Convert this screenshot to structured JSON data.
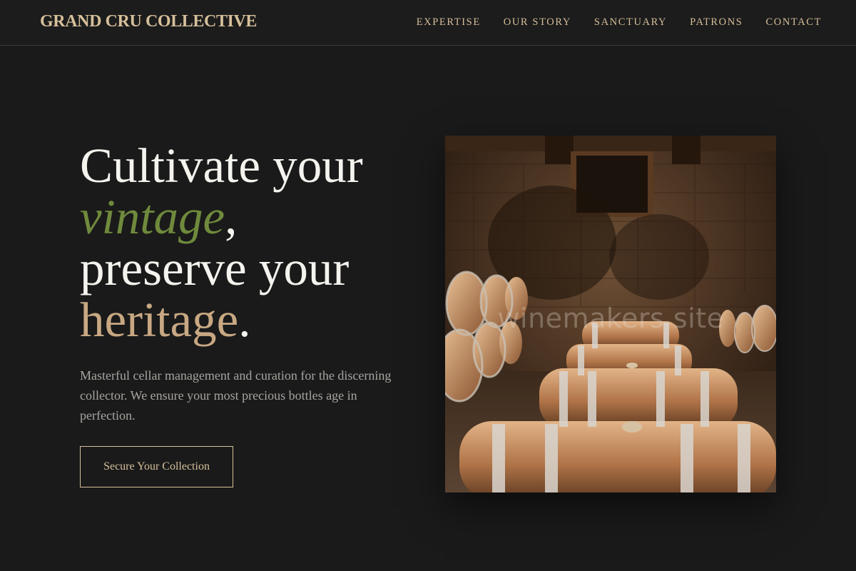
{
  "header": {
    "brand": "GRAND CRU COLLECTIVE",
    "nav": [
      {
        "label": "EXPERTISE"
      },
      {
        "label": "OUR STORY"
      },
      {
        "label": "SANCTUARY"
      },
      {
        "label": "PATRONS"
      },
      {
        "label": "CONTACT"
      }
    ]
  },
  "hero": {
    "headline": {
      "part1": "Cultivate your",
      "part2_emphasis": "vintage",
      "part2_punct": ",",
      "part3": "preserve your",
      "part4_emphasis": "heritage",
      "part4_punct": "."
    },
    "subcopy": "Masterful cellar management and curation for the discerning collector. We ensure your most precious bottles age in perfection.",
    "cta_label": "Secure Your Collection",
    "image": {
      "watermark": "winemakers site"
    }
  },
  "colors": {
    "background": "#1a1a1a",
    "brand_gold": "#d6bf9b",
    "vintage_green": "#6f8a3c",
    "heritage_tan": "#c8a883",
    "body_text": "#a8a5a0"
  }
}
